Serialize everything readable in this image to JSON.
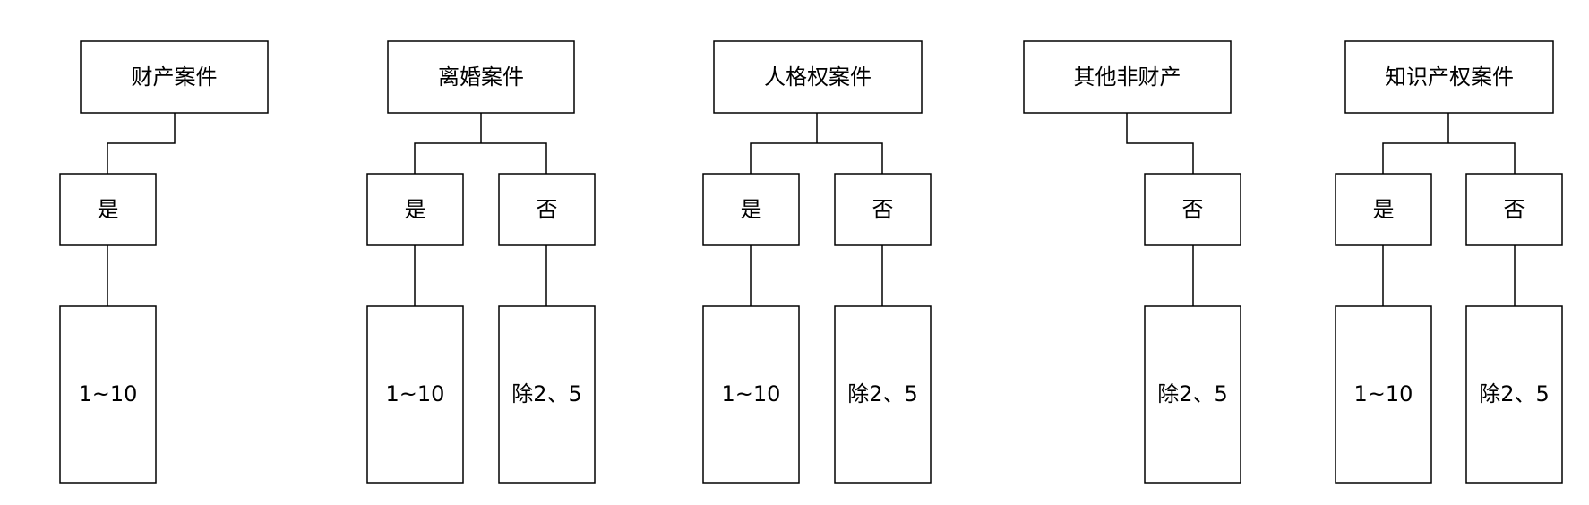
{
  "diagram": {
    "groups": [
      {
        "title": "财产案件",
        "branches": [
          {
            "label": "是",
            "value": "1~10"
          }
        ]
      },
      {
        "title": "离婚案件",
        "branches": [
          {
            "label": "是",
            "value": "1~10"
          },
          {
            "label": "否",
            "value": "除2、5"
          }
        ]
      },
      {
        "title": "人格权案件",
        "branches": [
          {
            "label": "是",
            "value": "1~10"
          },
          {
            "label": "否",
            "value": "除2、5"
          }
        ]
      },
      {
        "title": "其他非财产",
        "branches": [
          {
            "label": "否",
            "value": "除2、5"
          }
        ]
      },
      {
        "title": "知识产权案件",
        "branches": [
          {
            "label": "是",
            "value": "1~10"
          },
          {
            "label": "否",
            "value": "除2、5"
          }
        ]
      }
    ]
  }
}
